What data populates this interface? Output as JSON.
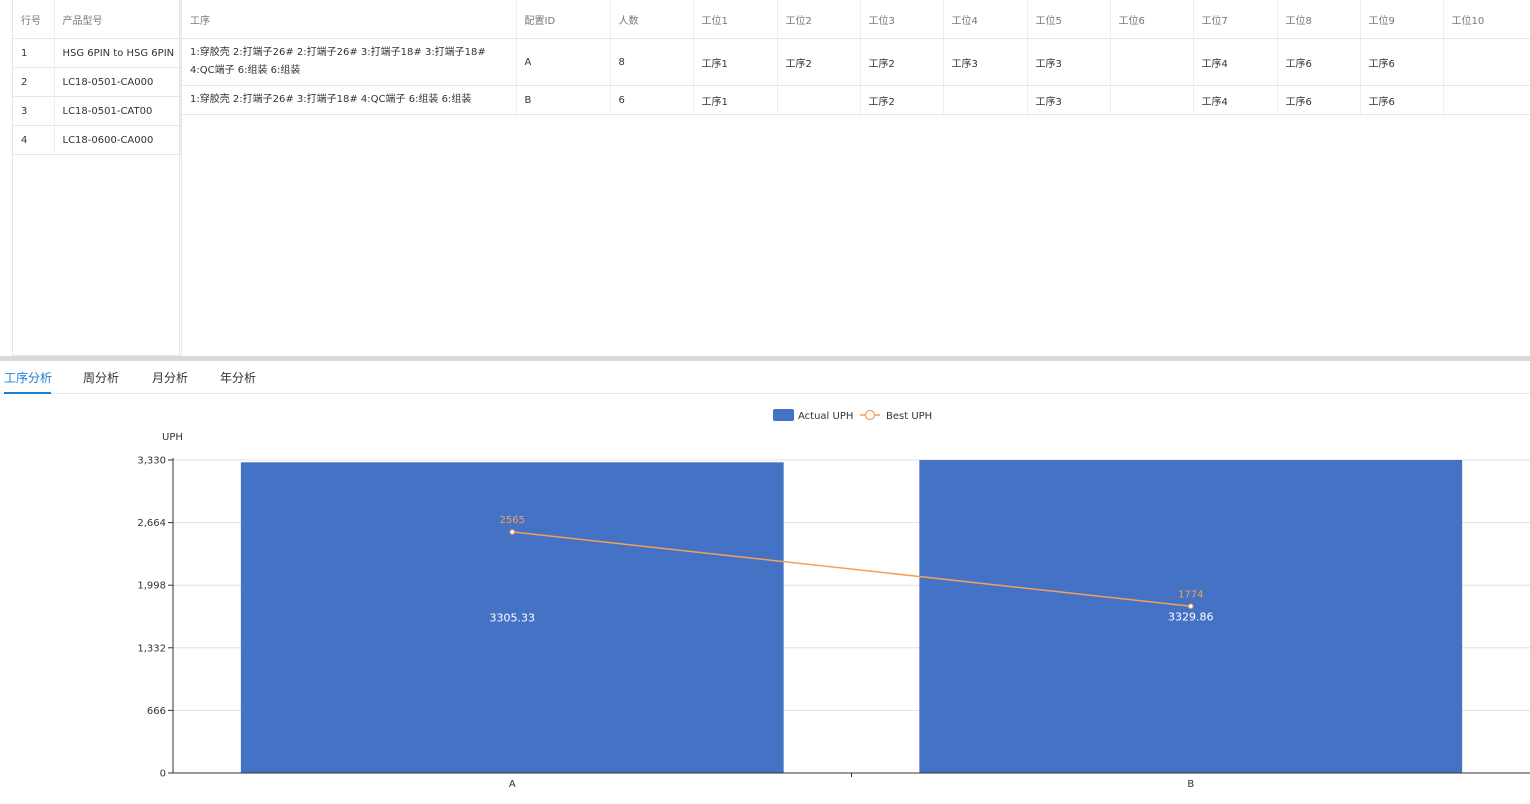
{
  "products": {
    "headers": [
      "行号",
      "产品型号"
    ],
    "rows": [
      [
        "1",
        "HSG 6PIN to HSG 6PIN"
      ],
      [
        "2",
        "LC18-0501-CA000"
      ],
      [
        "3",
        "LC18-0501-CAT00"
      ],
      [
        "4",
        "LC18-0600-CA000"
      ]
    ]
  },
  "config": {
    "headers": [
      "工序",
      "配置ID",
      "人数",
      "工位1",
      "工位2",
      "工位3",
      "工位4",
      "工位5",
      "工位6",
      "工位7",
      "工位8",
      "工位9",
      "工位10"
    ],
    "rows": [
      [
        "1:穿胶壳 2:打端子26# 2:打端子26# 3:打端子18# 3:打端子18# 4:QC端子 6:组装 6:组装",
        "A",
        "8",
        "工序1",
        "工序2",
        "工序2",
        "工序3",
        "工序3",
        "",
        "工序4",
        "工序6",
        "工序6",
        ""
      ],
      [
        "1:穿胶壳 2:打端子26# 3:打端子18# 4:QC端子 6:组装 6:组装",
        "B",
        "6",
        "工序1",
        "",
        "工序2",
        "",
        "工序3",
        "",
        "工序4",
        "工序6",
        "工序6",
        ""
      ]
    ]
  },
  "tabs": [
    "工序分析",
    "周分析",
    "月分析",
    "年分析"
  ],
  "chart_data": {
    "type": "bar",
    "categories": [
      "A",
      "B"
    ],
    "series": [
      {
        "name": "Actual UPH",
        "type": "bar",
        "values": [
          3305.33,
          3329.86
        ],
        "color": "#4472c4"
      },
      {
        "name": "Best UPH",
        "type": "line",
        "values": [
          2565,
          1774
        ],
        "color": "#f5a05a"
      }
    ],
    "ylabel": "UPH",
    "ylim": [
      0,
      3330
    ],
    "yticks": [
      "0",
      "666",
      "1,332",
      "1,998",
      "2,664",
      "3,330"
    ],
    "grid": true,
    "legend": "top-center"
  }
}
